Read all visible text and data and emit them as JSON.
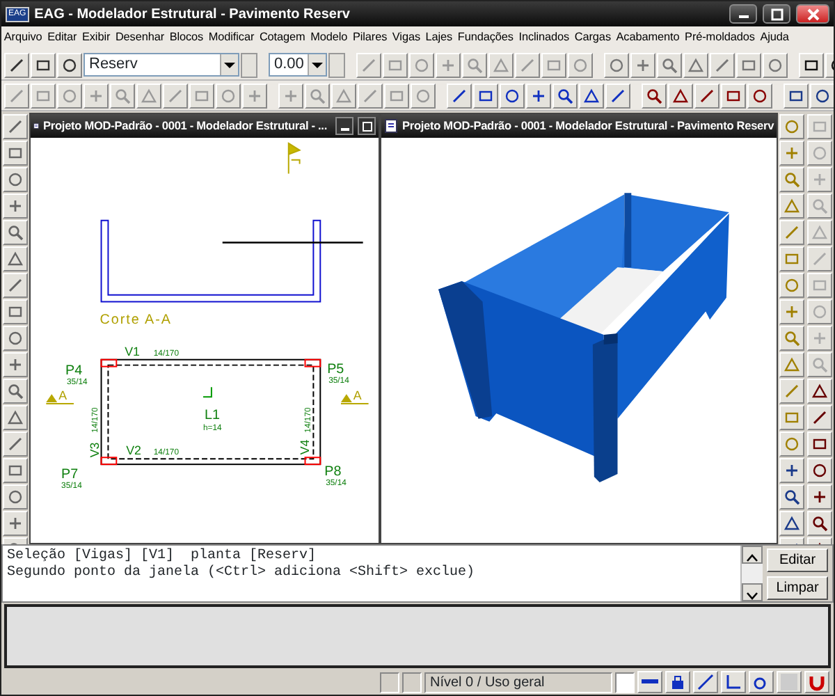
{
  "window": {
    "title": "EAG - Modelador Estrutural - Pavimento Reserv",
    "app_icon": "EAG"
  },
  "menu": [
    "Arquivo",
    "Editar",
    "Exibir",
    "Desenhar",
    "Blocos",
    "Modificar",
    "Cotagem",
    "Modelo",
    "Pilares",
    "Vigas",
    "Lajes",
    "Fundações",
    "Inclinados",
    "Cargas",
    "Acabamento",
    "Pré-moldados",
    "Ajuda"
  ],
  "toolbar": {
    "floor_combo": {
      "value": "Reserv"
    },
    "elevation_combo": {
      "value": "0.00"
    }
  },
  "documents": [
    {
      "kind": "plan",
      "title": "Projeto MOD-Padrão - 0001 - Modelador Estrutural - ...",
      "labels": [
        {
          "kind": "section",
          "text": "Corte A-A"
        },
        {
          "kind": "element",
          "text": "V1"
        },
        {
          "kind": "element",
          "text": "14/170"
        },
        {
          "kind": "element",
          "text": "P4"
        },
        {
          "kind": "element",
          "text": "35/14"
        },
        {
          "kind": "element",
          "text": "P5"
        },
        {
          "kind": "element",
          "text": "35/14"
        },
        {
          "kind": "section",
          "text": "A"
        },
        {
          "kind": "section",
          "text": "A"
        },
        {
          "kind": "element",
          "text": "L1"
        },
        {
          "kind": "element",
          "text": "h=14"
        },
        {
          "kind": "element",
          "text": "14/170"
        },
        {
          "kind": "element",
          "text": "V3"
        },
        {
          "kind": "element",
          "text": "14/170"
        },
        {
          "kind": "element",
          "text": "V4"
        },
        {
          "kind": "element",
          "text": "V2"
        },
        {
          "kind": "element",
          "text": "14/170"
        },
        {
          "kind": "element",
          "text": "P7"
        },
        {
          "kind": "element",
          "text": "35/14"
        },
        {
          "kind": "element",
          "text": "P8"
        },
        {
          "kind": "element",
          "text": "35/14"
        }
      ]
    },
    {
      "kind": "perspective",
      "title": "Projeto MOD-Padrão - 0001 - Modelador Estrutural - Pavimento Reserv"
    }
  ],
  "command": {
    "lines": [
      "Seleção [Vigas] [V1]  planta [Reserv]",
      "Segundo ponto da janela (<Ctrl> adiciona <Shift> exclue)"
    ],
    "buttons": [
      "Editar",
      "Limpar"
    ]
  },
  "status_bar": {
    "level": "Nível 0 / Uso geral"
  }
}
